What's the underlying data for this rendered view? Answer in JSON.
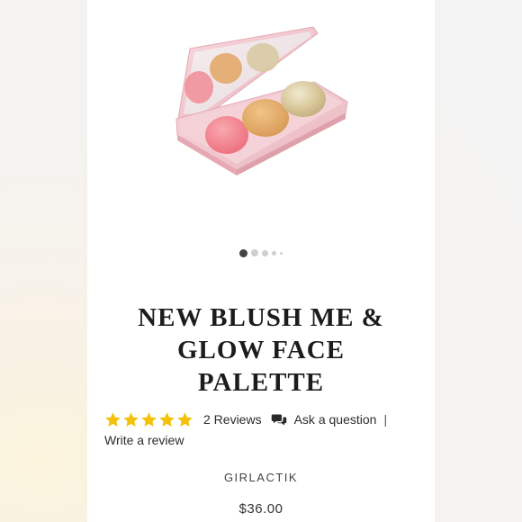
{
  "product": {
    "title_lines": [
      "NEW BLUSH ME &",
      "GLOW FACE",
      "PALETTE"
    ],
    "brand": "GIRLACTIK",
    "price": "$36.00"
  },
  "carousel": {
    "slide_count": 5,
    "active_index": 0
  },
  "rating": {
    "stars_filled": 5,
    "stars_total": 5,
    "reviews_label": "2 Reviews",
    "ask_label": "Ask a question",
    "separator": "|",
    "write_label": "Write a review"
  },
  "colors": {
    "star": "#f4c20d",
    "palette_case": "#f2c9d0",
    "blush": "#f07e89",
    "bronze": "#e2a868",
    "highlighter": "#dccca0"
  }
}
